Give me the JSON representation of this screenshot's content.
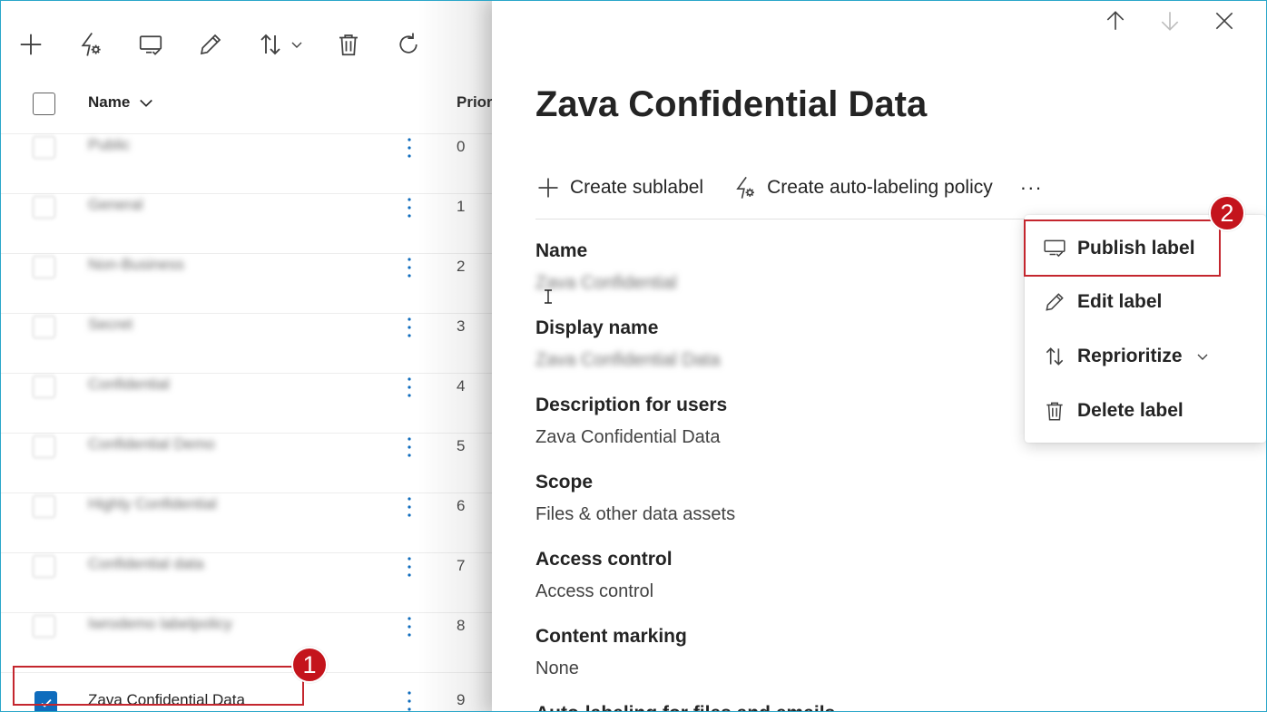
{
  "toolbar": {
    "icons": [
      "add-icon",
      "auto-label-icon",
      "publish-icon",
      "edit-icon",
      "sort-icon",
      "delete-icon",
      "refresh-icon"
    ]
  },
  "list": {
    "header": {
      "name": "Name",
      "priority": "Prior"
    },
    "rows": [
      {
        "name": "Public",
        "priority": "0"
      },
      {
        "name": "General",
        "priority": "1"
      },
      {
        "name": "Non-Business",
        "priority": "2"
      },
      {
        "name": "Secret",
        "priority": "3"
      },
      {
        "name": "Confidential",
        "priority": "4"
      },
      {
        "name": "Confidential Demo",
        "priority": "5"
      },
      {
        "name": "Highly Confidential",
        "priority": "6"
      },
      {
        "name": "Confidential data",
        "priority": "7"
      },
      {
        "name": "Iwrodemo labelpolicy",
        "priority": "8"
      },
      {
        "name": "Zava Confidential Data",
        "priority": "9",
        "selected": true
      }
    ]
  },
  "panel": {
    "title": "Zava Confidential Data",
    "commands": {
      "create_sublabel": "Create sublabel",
      "create_auto_policy": "Create auto-labeling policy",
      "overflow": "···"
    },
    "properties": {
      "name_label": "Name",
      "name_value": "Zava Confidential",
      "display_name_label": "Display name",
      "display_name_value": "Zava Confidential Data",
      "description_label": "Description for users",
      "description_value": "Zava Confidential Data",
      "scope_label": "Scope",
      "scope_value": "Files & other data assets",
      "access_control_label": "Access control",
      "access_control_value": "Access control",
      "content_marking_label": "Content marking",
      "content_marking_value": "None",
      "auto_labeling_label": "Auto-labeling for files and emails"
    }
  },
  "menu": {
    "publish": "Publish label",
    "edit": "Edit label",
    "reprioritize": "Reprioritize",
    "delete": "Delete label"
  },
  "badges": {
    "step1": "1",
    "step2": "2"
  },
  "colors": {
    "accent": "#0f6cbd",
    "highlight": "#c4262e",
    "badge": "#c4141c"
  }
}
